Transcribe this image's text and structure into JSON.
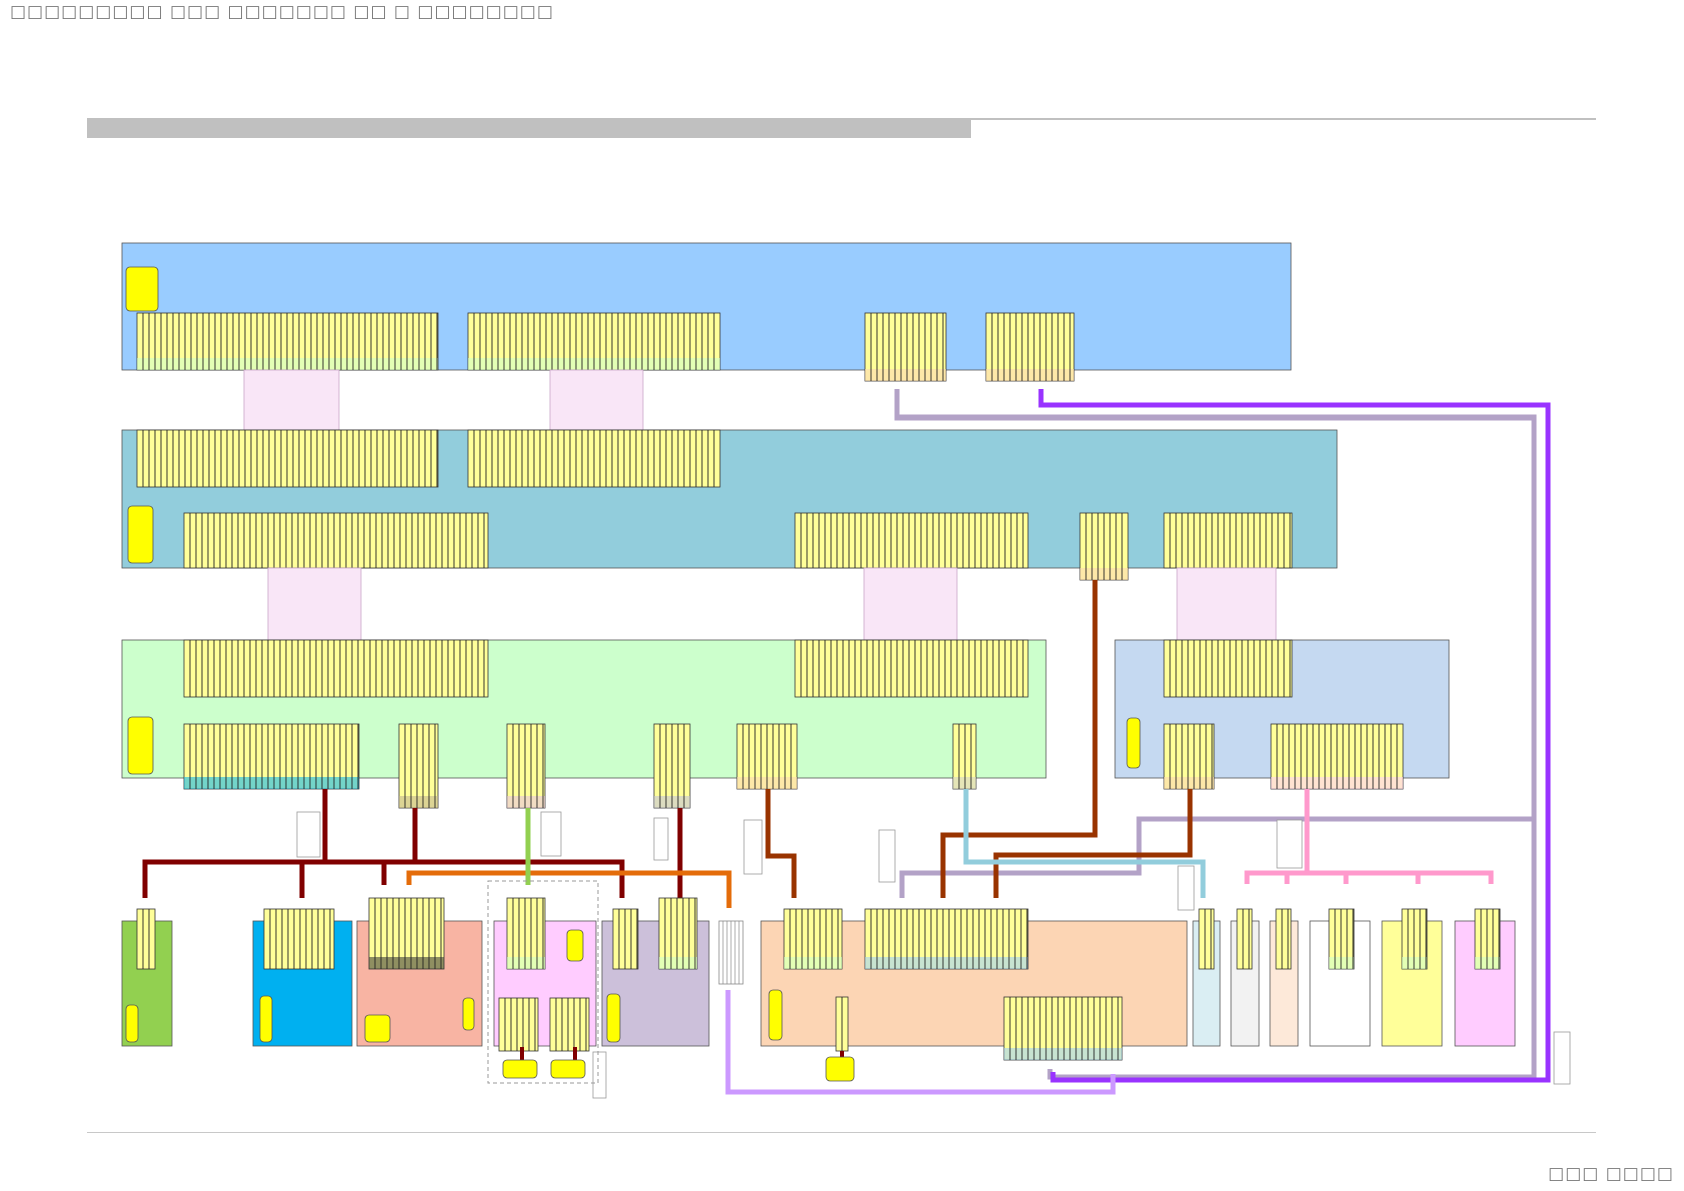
{
  "page": {
    "header_text": "□□□□□□□□□ □□□ □□□□□□□ □□ □ □□□□□□□□",
    "footer_text": "□□□ □□□□"
  },
  "colors": {
    "board_top": "#99ccff",
    "board_middle": "#92cddc",
    "board_lower_left": "#ccffcc",
    "board_lower_right": "#c5d9f1",
    "connector_fill": "#ffff99",
    "connector_gap": "#f9e6f7",
    "chip": "#ffff00",
    "cable_darkred": "#800000",
    "cable_orange": "#e46c0a",
    "cable_green": "#92d050",
    "cable_brown": "#993300",
    "cable_lilac": "#b3a2c7",
    "cable_purple": "#9933ff",
    "cable_lightblue": "#92cddc",
    "cable_pink": "#ff99cc",
    "cable_lavender": "#cc99ff",
    "module_green": "#92d050",
    "module_blue": "#00b0f0",
    "module_salmon": "#f8b4a3",
    "module_pink": "#ffccff",
    "module_lavender": "#ccc0da",
    "module_peach": "#fcd5b4",
    "module_lightcyan": "#daeef3",
    "module_lightgray": "#f2f2f2",
    "module_lightpeach": "#fde9d9",
    "module_white": "#ffffff",
    "module_yellow": "#ffff99",
    "module_lightpink": "#ffccff"
  }
}
